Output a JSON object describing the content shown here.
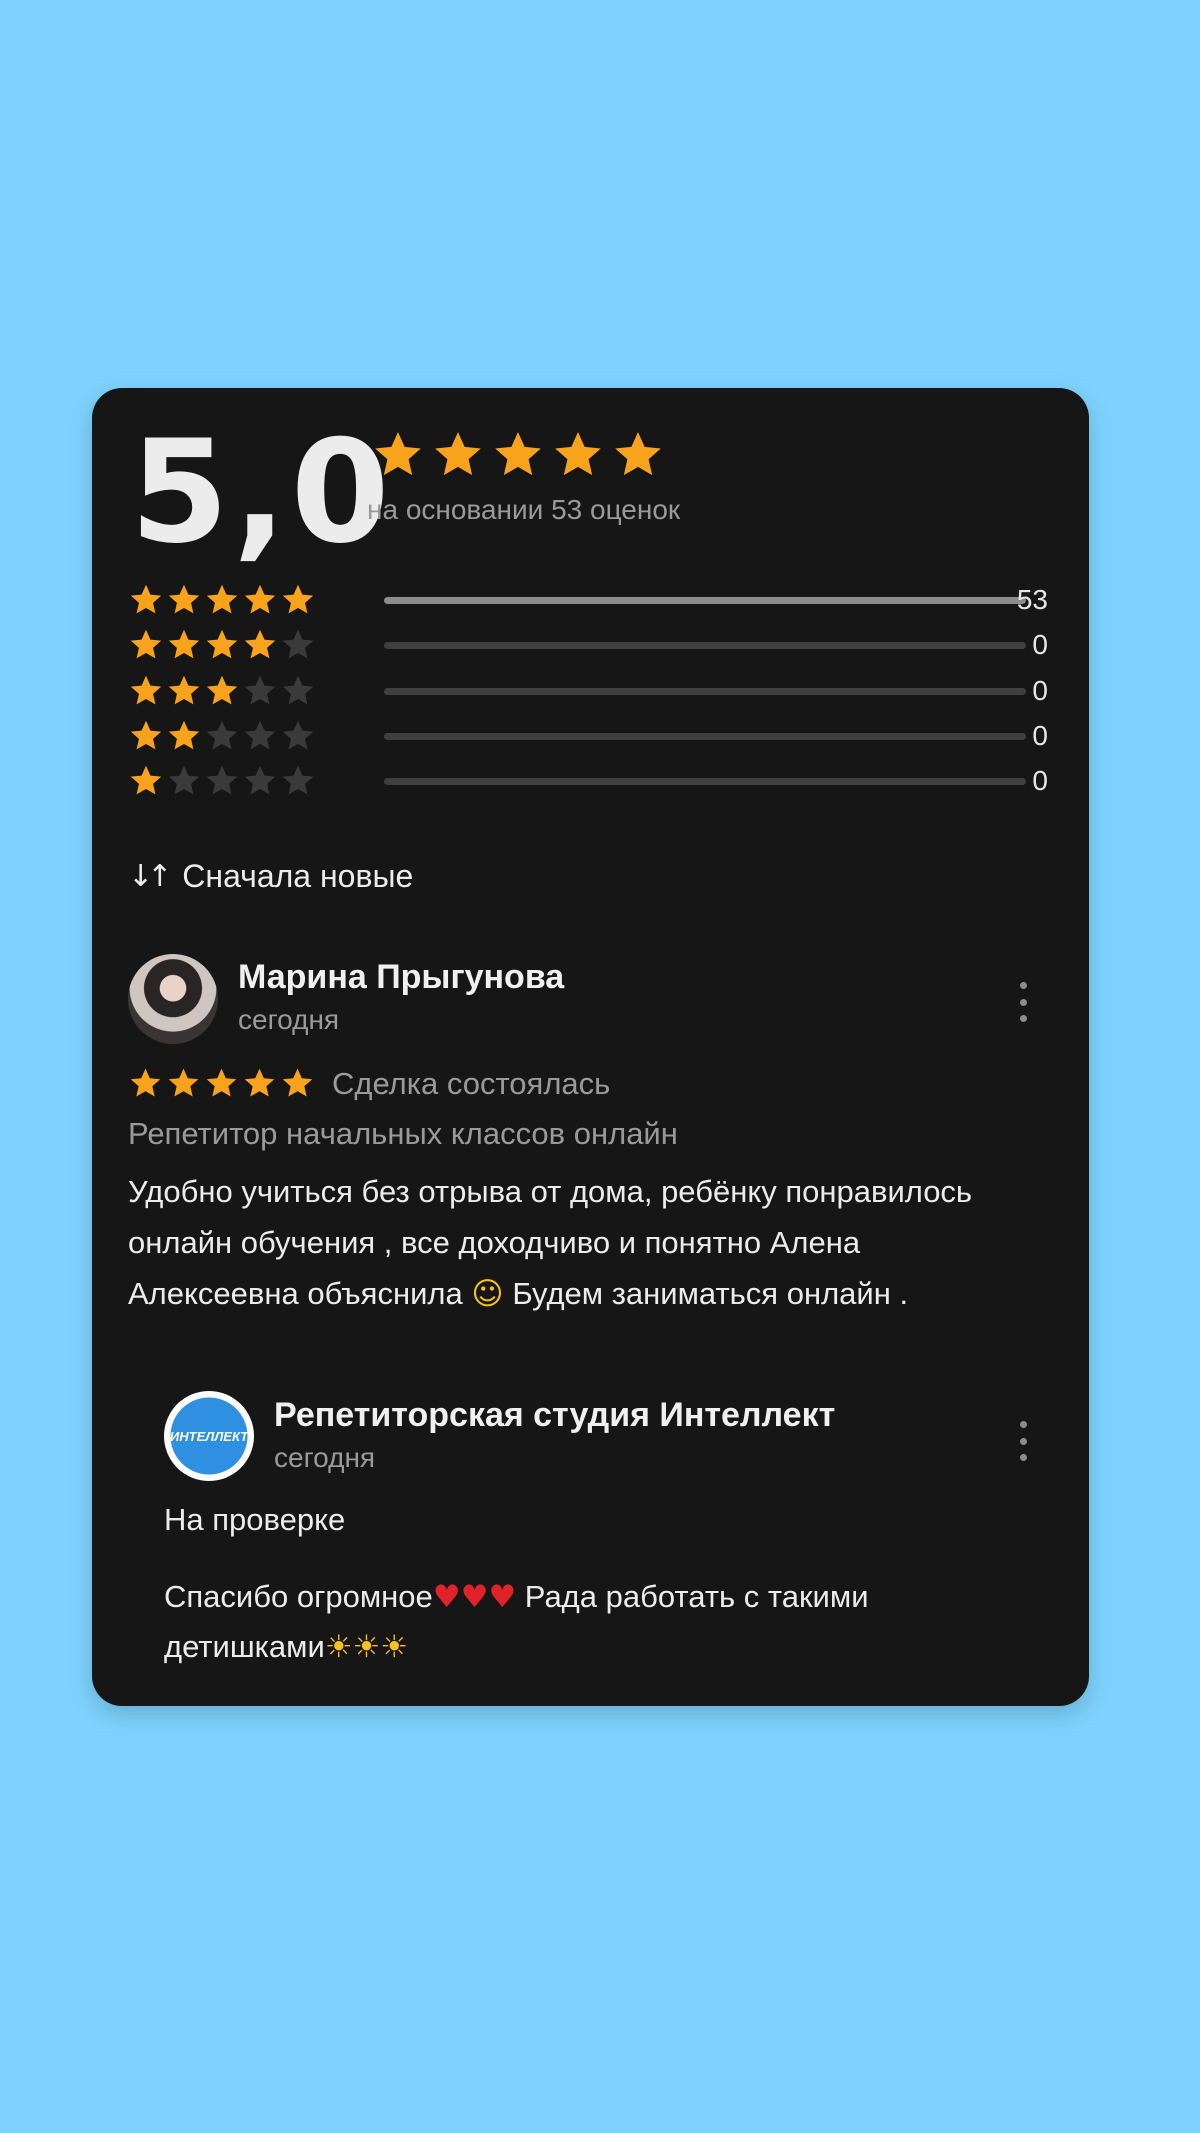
{
  "rating": {
    "score": "5,0",
    "stars": 5,
    "based_on": "на основании 53 оценок"
  },
  "distribution": [
    {
      "stars": 5,
      "count": "53",
      "fraction": 1.0
    },
    {
      "stars": 4,
      "count": "0",
      "fraction": 0
    },
    {
      "stars": 3,
      "count": "0",
      "fraction": 0
    },
    {
      "stars": 2,
      "count": "0",
      "fraction": 0
    },
    {
      "stars": 1,
      "count": "0",
      "fraction": 0
    }
  ],
  "sort": {
    "icon": "sort-arrows-icon",
    "label": "Сначала новые"
  },
  "review": {
    "author": "Марина Прыгунова",
    "date": "сегодня",
    "stars": 5,
    "deal_status": "Сделка состоялась",
    "service": "Репетитор начальных классов онлайн",
    "text_part1": "Удобно учиться без отрыва от дома, ребёнку понравилось онлайн обучения , все доходчиво и понятно Алена Алексеевна объяснила",
    "text_part2": "Будем заниматься онлайн ."
  },
  "reply": {
    "author": "Репетиторская студия Интеллект",
    "logo_text": "ИНТЕЛЛЕКТ",
    "date": "сегодня",
    "status": "На проверке",
    "text_part1": "Спасибо огромное",
    "text_part2": "Рада работать с такими детишками"
  },
  "colors": {
    "background": "#7dd3fd",
    "card": "#161616",
    "star_active": "#f9a21b",
    "star_inactive": "#3a3a3a"
  }
}
